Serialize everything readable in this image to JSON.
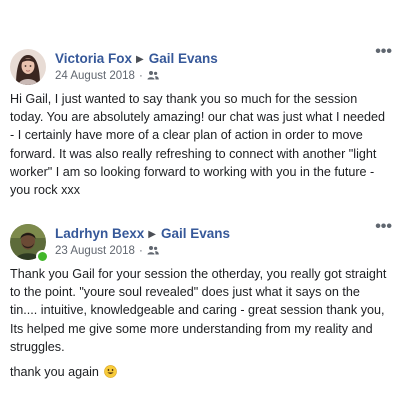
{
  "posts": [
    {
      "author": "Victoria Fox",
      "recipient": "Gail Evans",
      "date": "24 August 2018",
      "dot": "·",
      "audience_icon": "friends-icon",
      "more_label": "•••",
      "online": false,
      "paragraphs": [
        "Hi Gail, I just wanted to say thank you so much for the session today. You are absolutely amazing! our chat was just what I needed - I certainly have more of a clear plan of action in order to move forward. It was also really refreshing to connect with another \"light worker\" I am so looking forward to working with you in the future - you rock xxx"
      ]
    },
    {
      "author": "Ladrhyn Bexx",
      "recipient": "Gail Evans",
      "date": "23 August 2018",
      "dot": "·",
      "audience_icon": "friends-icon",
      "more_label": "•••",
      "online": true,
      "paragraphs": [
        "Thank you Gail for your session the otherday, you really got straight to the point. \"youre soul revealed\" does just what it says on the tin.... intuitive, knowledgeable and caring - great session thank you, Its helped me give some more understanding from my reality and struggles.",
        "thank you again"
      ],
      "emoji": "smiley-emoji-icon"
    }
  ],
  "colors": {
    "name_link": "#365899",
    "meta": "#616770",
    "online": "#42b72a"
  }
}
